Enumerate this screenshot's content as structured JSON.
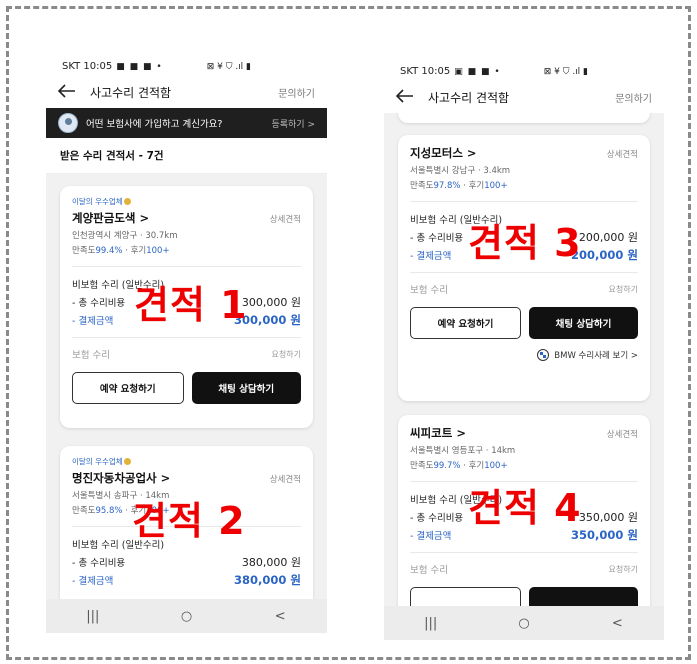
{
  "colors": {
    "accent": "#2a64c4",
    "overlay_red": "#ee0000",
    "dark_button": "#111111",
    "border_dash": "#8a8a8a"
  },
  "phoneA": {
    "status": {
      "time": "SKT 10:05",
      "dots": "■ ■ ■ •",
      "sys": "⊠ ¥ ⛉ .ıl ▮"
    },
    "appbar": {
      "title": "사고수리 견적함",
      "link": "문의하기"
    },
    "banner": {
      "text": "어떤 보험사에 가입하고 계신가요?",
      "link": "등록하기 >"
    },
    "section_title": "받은 수리 견적서 - 7건",
    "cards": [
      {
        "badge": "이달의 우수업체",
        "name": "계양판금도색 >",
        "detail_link": "상세견적",
        "location": "인천광역시 계양구 · 30.7km",
        "rating_prefix": "만족도",
        "rating_pct": "99.4%",
        "rating_mid": " · 후기",
        "rating_count": "100+",
        "section": "비보험 수리 (일반수리)",
        "total_label": "- 총 수리비용",
        "total_amount": "300,000 원",
        "pay_label": "- 결제금액",
        "pay_amount": "300,000 원",
        "ins_label": "보험 수리",
        "ins_req": "요청하기",
        "btn_reserve": "예약 요청하기",
        "btn_chat": "채팅 상담하기"
      },
      {
        "badge": "이달의 우수업체",
        "name": "명진자동차공업사 >",
        "detail_link": "상세견적",
        "location": "서울특별시 송파구 · 14km",
        "rating_prefix": "만족도",
        "rating_pct": "95.8%",
        "rating_mid": " · 후기",
        "rating_count": "100+",
        "section": "비보험 수리 (일반수리)",
        "total_label": "- 총 수리비용",
        "total_amount": "380,000 원",
        "pay_label": "- 결제금액",
        "pay_amount": "380,000 원"
      }
    ],
    "nav": [
      "|||",
      "○",
      "<"
    ]
  },
  "phoneB": {
    "status": {
      "time": "SKT 10:05",
      "dots": "▣ ■ ■ •",
      "sys": "⊠ ¥ ⛉ .ıl ▮"
    },
    "appbar": {
      "title": "사고수리 견적함",
      "link": "문의하기"
    },
    "cards": [
      {
        "name": "지성모터스 >",
        "detail_link": "상세견적",
        "location": "서울특별시 강남구 · 3.4km",
        "rating_prefix": "만족도",
        "rating_pct": "97.8%",
        "rating_mid": " · 후기",
        "rating_count": "100+",
        "section": "비보험 수리 (일반수리)",
        "total_label": "- 총 수리비용",
        "total_amount": "200,000 원",
        "pay_label": "- 결제금액",
        "pay_amount": "200,000 원",
        "ins_label": "보험 수리",
        "ins_req": "요청하기",
        "btn_reserve": "예약 요청하기",
        "btn_chat": "채팅 상담하기",
        "bmw_link": "BMW 수리사례 보기 >"
      },
      {
        "name": "씨피코트 >",
        "detail_link": "상세견적",
        "location": "서울특별시 영등포구 · 14km",
        "rating_prefix": "만족도",
        "rating_pct": "99.7%",
        "rating_mid": " · 후기",
        "rating_count": "100+",
        "section": "비보험 수리 (일반수리)",
        "total_label": "- 총 수리비용",
        "total_amount": "350,000 원",
        "pay_label": "- 결제금액",
        "pay_amount": "350,000 원",
        "ins_label": "보험 수리",
        "ins_req": "요청하기"
      }
    ],
    "nav": [
      "|||",
      "○",
      "<"
    ]
  },
  "overlays": [
    "견적 1",
    "견적 2",
    "견적 3",
    "견적 4"
  ]
}
